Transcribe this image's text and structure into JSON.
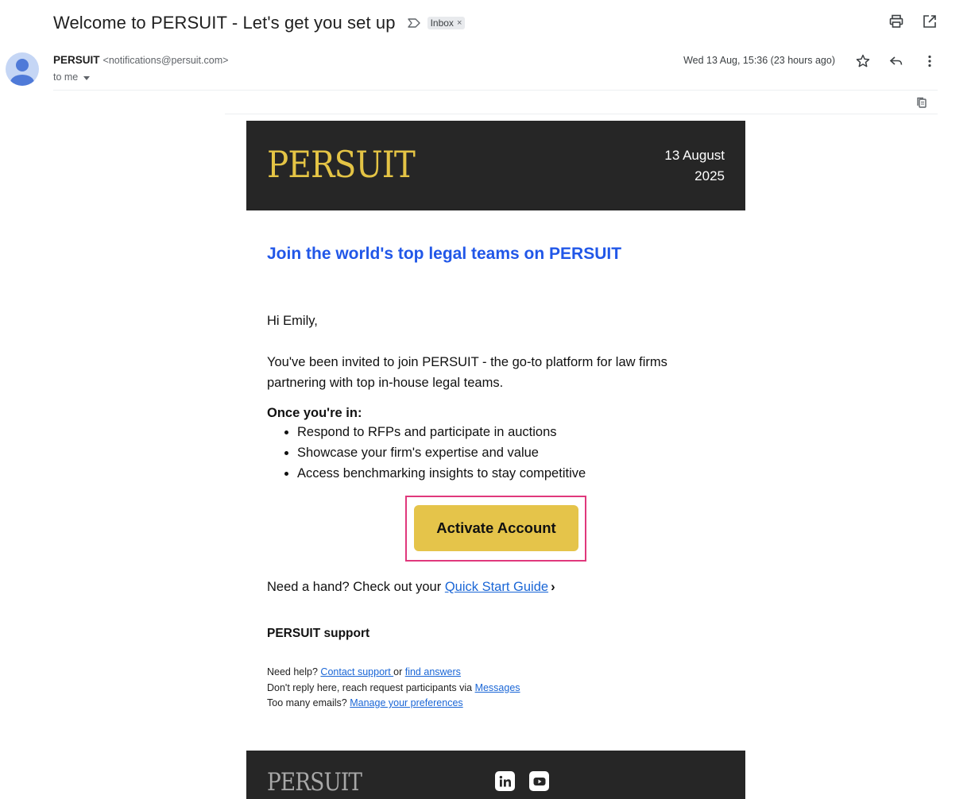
{
  "email": {
    "subject": "Welcome to PERSUIT - Let's get you set up",
    "label": "Inbox",
    "label_remove": "×",
    "sender_name": "PERSUIT",
    "sender_email": "<notifications@persuit.com>",
    "recipient": "to me",
    "date": "Wed 13 Aug, 15:36 (23 hours ago)"
  },
  "icons": {
    "importance": "importance-marker-icon",
    "print": "print-icon",
    "popout": "open-in-new-window-icon",
    "star": "star-icon",
    "reply": "reply-icon",
    "more": "more-vert-icon",
    "copy": "copy-icon"
  },
  "body": {
    "brand": "PERSUIT",
    "date_line1": "13 August",
    "date_line2": "2025",
    "headline": "Join the world's top legal teams on PERSUIT",
    "greeting": "Hi Emily,",
    "intro": "You've been invited to join PERSUIT - the go-to platform for law firms partnering with top in-house legal teams.",
    "list_title": "Once you're in:",
    "bullets": [
      "Respond to RFPs and participate in auctions",
      "Showcase your firm's expertise and value",
      "Access benchmarking insights to stay competitive"
    ],
    "cta": "Activate Account",
    "hand_prefix": "Need a hand? Check out your ",
    "hand_link": "Quick Start Guide",
    "hand_chevron": "›",
    "support_title": "PERSUIT support",
    "help_prefix": "Need help? ",
    "contact_link": "Contact support ",
    "help_or": "or ",
    "find_link": "find answers",
    "reply_prefix": "Don't reply here, reach request participants via ",
    "messages_link": "Messages",
    "emails_prefix": "Too many emails? ",
    "preferences_link": "Manage your preferences",
    "footer_brand": "PERSUIT",
    "social": [
      "linkedin-icon",
      "youtube-icon"
    ]
  },
  "colors": {
    "brand_gold": "#e4c445",
    "cta_gold": "#e5c44a",
    "hero_dark": "#262626",
    "headline_blue": "#2157e8",
    "link_blue": "#1a66d6",
    "highlight_pink": "#e0387c"
  }
}
